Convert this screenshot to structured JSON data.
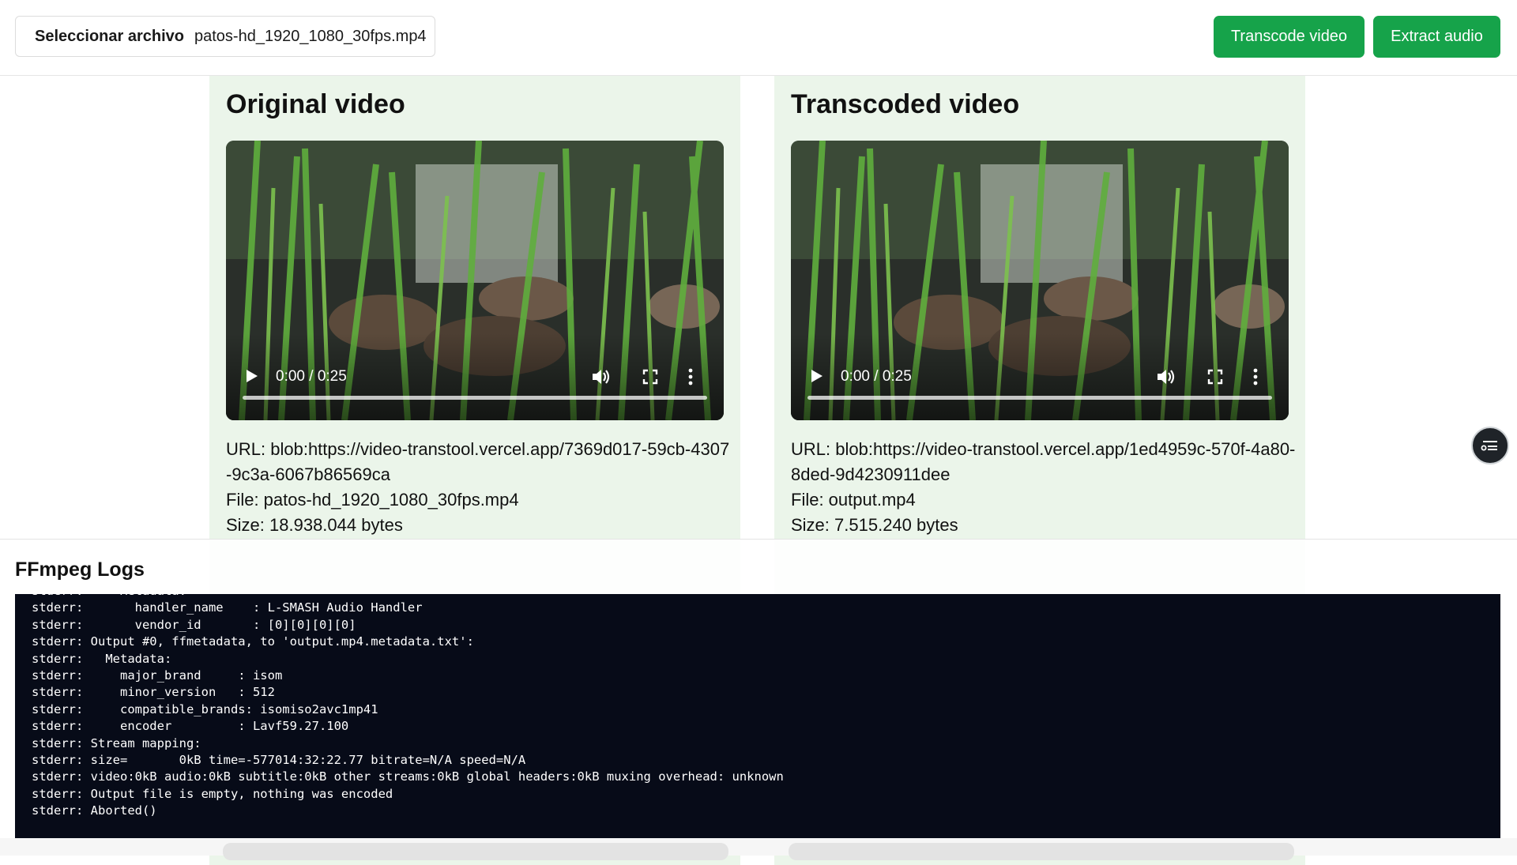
{
  "header": {
    "file_button_label": "Seleccionar archivo",
    "file_name": "patos-hd_1920_1080_30fps.mp4",
    "transcode_label": "Transcode video",
    "extract_label": "Extract audio"
  },
  "colors": {
    "accent": "#16a34a",
    "panel_bg": "#ebf5ea",
    "log_bg": "#070b18"
  },
  "original": {
    "title": "Original video",
    "time": "0:00 / 0:25",
    "progress": 0,
    "url_line": "URL: blob:https://video-transtool.vercel.app/7369d017-59cb-4307-9c3a-6067b86569ca",
    "file_line": "File: patos-hd_1920_1080_30fps.mp4",
    "size_line": "Size: 18.938.044 bytes"
  },
  "transcoded": {
    "title": "Transcoded video",
    "time": "0:00 / 0:25",
    "progress": 0,
    "url_line": "URL: blob:https://video-transtool.vercel.app/1ed4959c-570f-4a80-8ded-9d4230911dee",
    "file_line": "File: output.mp4",
    "size_line": "Size: 7.515.240 bytes"
  },
  "icons": {
    "play": "play-icon",
    "volume": "volume-icon",
    "fullscreen": "fullscreen-icon",
    "more": "more-options-icon",
    "fab": "chat-list-icon"
  },
  "logs": {
    "title": "FFmpeg Logs",
    "lines": [
      "stderr:     Metadata:",
      "stderr:       handler_name    : L-SMASH Audio Handler",
      "stderr:       vendor_id       : [0][0][0][0]",
      "stderr: Output #0, ffmetadata, to 'output.mp4.metadata.txt':",
      "stderr:   Metadata:",
      "stderr:     major_brand     : isom",
      "stderr:     minor_version   : 512",
      "stderr:     compatible_brands: isomiso2avc1mp41",
      "stderr:     encoder         : Lavf59.27.100",
      "stderr: Stream mapping:",
      "stderr: size=       0kB time=-577014:32:22.77 bitrate=N/A speed=N/A",
      "stderr: video:0kB audio:0kB subtitle:0kB other streams:0kB global headers:0kB muxing overhead: unknown",
      "stderr: Output file is empty, nothing was encoded",
      "stderr: Aborted()"
    ]
  }
}
